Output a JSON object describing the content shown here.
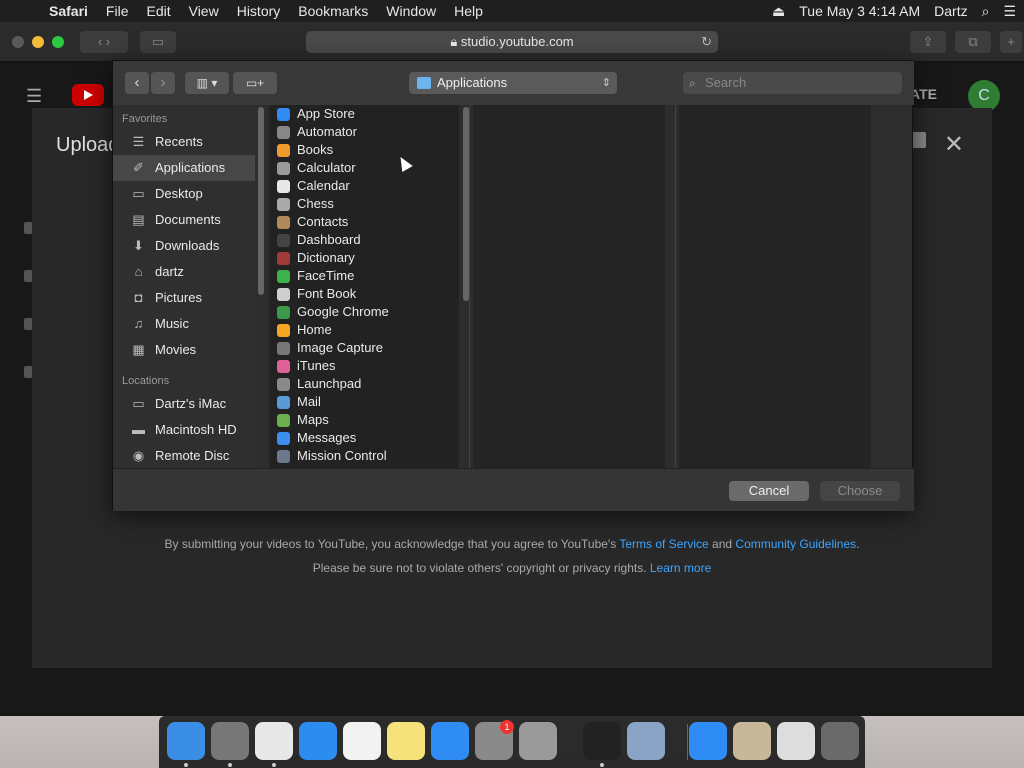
{
  "menubar": {
    "app": "Safari",
    "items": [
      "File",
      "Edit",
      "View",
      "History",
      "Bookmarks",
      "Window",
      "Help"
    ],
    "datetime": "Tue May 3  4:14 AM",
    "user": "Dartz"
  },
  "browser": {
    "url": "studio.youtube.com"
  },
  "youtube": {
    "upload_title": "Upload",
    "create_label": "ATE",
    "avatar_letter": "C",
    "terms_prefix": "By submitting your videos to YouTube, you acknowledge that you agree to YouTube's ",
    "terms_link": "Terms of Service",
    "terms_and": " and ",
    "guidelines_link": "Community Guidelines",
    "terms_suffix": ".",
    "privacy_text": "Please be sure not to violate others' copyright or privacy rights. ",
    "learn_more": "Learn more"
  },
  "file_dialog": {
    "location": "Applications",
    "search_placeholder": "Search",
    "favorites_header": "Favorites",
    "favorites": [
      {
        "label": "Recents",
        "icon": "recents-icon"
      },
      {
        "label": "Applications",
        "icon": "applications-icon",
        "selected": true
      },
      {
        "label": "Desktop",
        "icon": "desktop-icon"
      },
      {
        "label": "Documents",
        "icon": "documents-icon"
      },
      {
        "label": "Downloads",
        "icon": "downloads-icon"
      },
      {
        "label": "dartz",
        "icon": "home-icon"
      },
      {
        "label": "Pictures",
        "icon": "pictures-icon"
      },
      {
        "label": "Music",
        "icon": "music-icon"
      },
      {
        "label": "Movies",
        "icon": "movies-icon"
      }
    ],
    "locations_header": "Locations",
    "locations": [
      {
        "label": "Dartz's iMac",
        "icon": "computer-icon"
      },
      {
        "label": "Macintosh HD",
        "icon": "disk-icon"
      },
      {
        "label": "Remote Disc",
        "icon": "remote-disc-icon"
      }
    ],
    "apps": [
      {
        "label": "App Store",
        "color": "#2f8cf5"
      },
      {
        "label": "Automator",
        "color": "#888888"
      },
      {
        "label": "Books",
        "color": "#f09a2e"
      },
      {
        "label": "Calculator",
        "color": "#9a9a9a"
      },
      {
        "label": "Calendar",
        "color": "#e8e8e8"
      },
      {
        "label": "Chess",
        "color": "#aaaaaa"
      },
      {
        "label": "Contacts",
        "color": "#b08a5a"
      },
      {
        "label": "Dashboard",
        "color": "#444444"
      },
      {
        "label": "Dictionary",
        "color": "#a33a3a"
      },
      {
        "label": "FaceTime",
        "color": "#3cb34a"
      },
      {
        "label": "Font Book",
        "color": "#cfcfcf"
      },
      {
        "label": "Google Chrome",
        "color": "#3a9a4a"
      },
      {
        "label": "Home",
        "color": "#f5a623"
      },
      {
        "label": "Image Capture",
        "color": "#777777"
      },
      {
        "label": "iTunes",
        "color": "#e0609a"
      },
      {
        "label": "Launchpad",
        "color": "#8a8a8a"
      },
      {
        "label": "Mail",
        "color": "#5a9ad8"
      },
      {
        "label": "Maps",
        "color": "#6ab04c"
      },
      {
        "label": "Messages",
        "color": "#3c8ef0"
      },
      {
        "label": "Mission Control",
        "color": "#6a7a8a"
      }
    ],
    "cancel_label": "Cancel",
    "choose_label": "Choose"
  },
  "dock": {
    "badge_count": "1",
    "items": [
      {
        "name": "finder",
        "color": "#3a8ee6"
      },
      {
        "name": "launchpad",
        "color": "#777777"
      },
      {
        "name": "chrome",
        "color": "#e8e8e8"
      },
      {
        "name": "safari",
        "color": "#2d8cf0"
      },
      {
        "name": "calendar",
        "color": "#f2f2f2"
      },
      {
        "name": "notes",
        "color": "#f6e27a"
      },
      {
        "name": "app-store",
        "color": "#2f8cf5"
      },
      {
        "name": "system-preferences",
        "color": "#8a8a8a"
      },
      {
        "name": "utility",
        "color": "#9a9a9a"
      },
      {
        "name": "terminal",
        "color": "#222222"
      },
      {
        "name": "preview",
        "color": "#8aa4c8"
      },
      {
        "name": "app-store-2",
        "color": "#2f8cf5"
      },
      {
        "name": "photos-folder",
        "color": "#c8b89a"
      },
      {
        "name": "downloads-stack",
        "color": "#dddddd"
      },
      {
        "name": "trash",
        "color": "#6a6a6a"
      }
    ]
  }
}
